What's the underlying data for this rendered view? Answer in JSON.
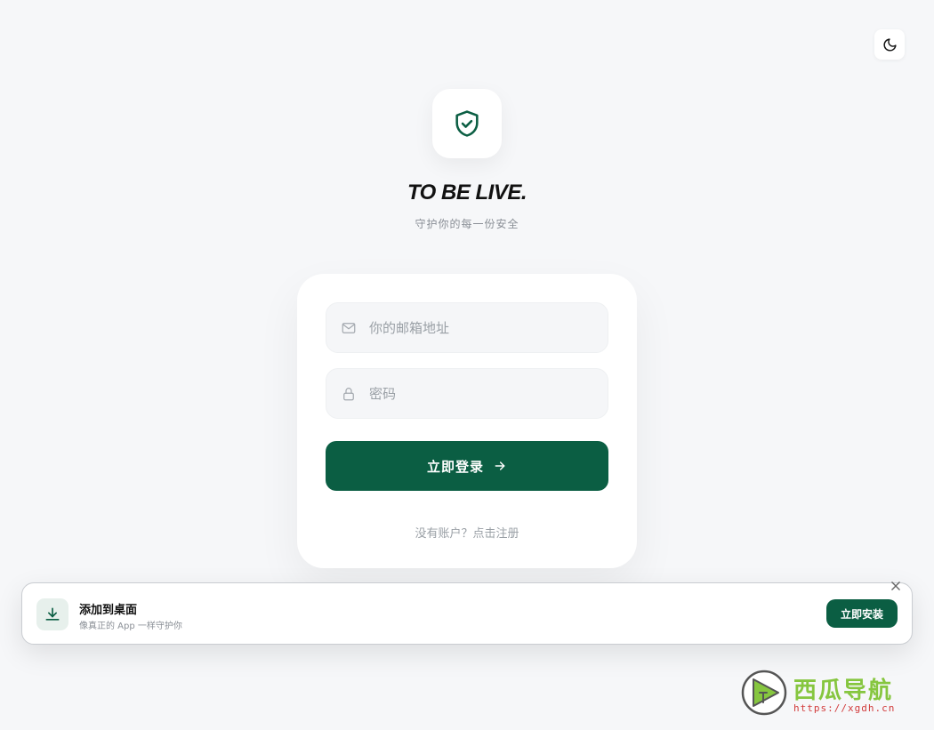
{
  "theme_toggle": {
    "icon": "moon-icon"
  },
  "brand": {
    "logo_icon": "shield-check-icon",
    "title": "TO BE LIVE.",
    "subtitle": "守护你的每一份安全"
  },
  "login": {
    "email_placeholder": "你的邮箱地址",
    "email_icon": "mail-icon",
    "password_placeholder": "密码",
    "password_icon": "lock-icon",
    "submit_label": "立即登录",
    "submit_icon": "arrow-right-icon",
    "register_text": "没有账户？点击注册"
  },
  "install_banner": {
    "icon": "download-icon",
    "title": "添加到桌面",
    "description": "像真正的 App 一样守护你",
    "button_label": "立即安装",
    "close_icon": "close-icon"
  },
  "watermark": {
    "title": "西瓜导航",
    "url": "https://xgdh.cn"
  },
  "colors": {
    "accent": "#0b5e43",
    "background": "#f6f7f9",
    "watermark_green": "#86c63f",
    "watermark_red": "#d23b3b"
  }
}
